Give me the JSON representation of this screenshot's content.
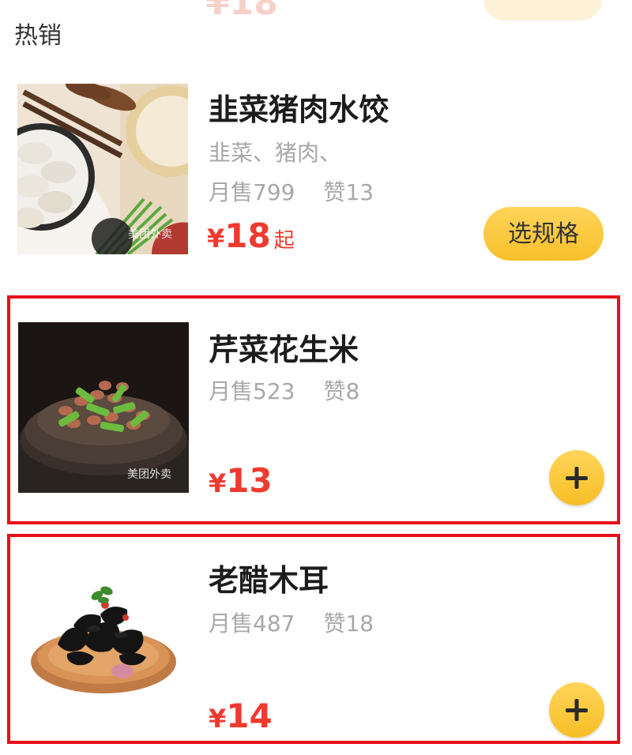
{
  "section": {
    "title": "热销"
  },
  "items": [
    {
      "name": "韭菜猪肉水饺",
      "ingredients": "韭菜、猪肉、",
      "monthly_sales": "月售799",
      "likes": "赞13",
      "price_currency": "¥",
      "price_value": "18",
      "price_suffix": "起",
      "action_label": "选规格",
      "image_icon": "dumplings-photo"
    },
    {
      "name": "芹菜花生米",
      "monthly_sales": "月售523",
      "likes": "赞8",
      "price_currency": "¥",
      "price_value": "13",
      "action_icon": "plus-icon",
      "image_icon": "celery-peanuts-photo"
    },
    {
      "name": "老醋木耳",
      "monthly_sales": "月售487",
      "likes": "赞18",
      "price_currency": "¥",
      "price_value": "14",
      "action_icon": "plus-icon",
      "image_icon": "vinegar-fungus-photo"
    }
  ],
  "colors": {
    "price": "#ee3a2f",
    "button": "#f7c02a",
    "highlight_border": "#e8101a",
    "secondary_text": "#a8a8a8"
  }
}
